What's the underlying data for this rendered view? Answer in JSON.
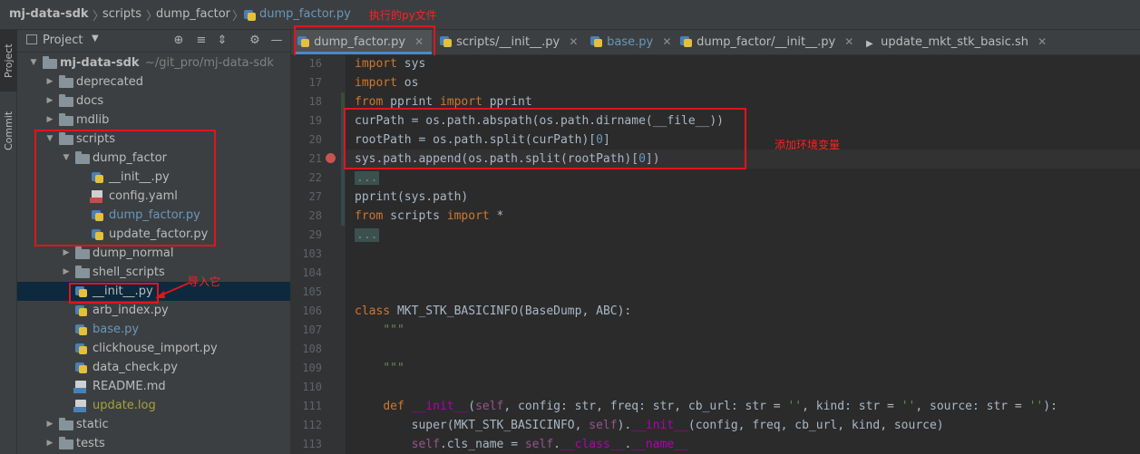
{
  "breadcrumb": {
    "items": [
      "mj-data-sdk",
      "scripts",
      "dump_factor",
      "dump_factor.py"
    ],
    "annotation": "执行的py文件"
  },
  "stripe": {
    "project_label": "Project",
    "commit_label": "Commit"
  },
  "project_panel": {
    "title": "Project",
    "tree": [
      {
        "label": "mj-data-sdk",
        "hint": "~/git_pro/mj-data-sdk",
        "kind": "folder",
        "expanded": true
      },
      {
        "label": "deprecated",
        "kind": "folder"
      },
      {
        "label": "docs",
        "kind": "folder"
      },
      {
        "label": "mdlib",
        "kind": "folder"
      },
      {
        "label": "scripts",
        "kind": "folder",
        "expanded": true
      },
      {
        "label": "dump_factor",
        "kind": "folder",
        "expanded": true
      },
      {
        "label": "__init__.py",
        "kind": "py"
      },
      {
        "label": "config.yaml",
        "kind": "yaml"
      },
      {
        "label": "dump_factor.py",
        "kind": "py",
        "color": "blue"
      },
      {
        "label": "update_factor.py",
        "kind": "py"
      },
      {
        "label": "dump_normal",
        "kind": "folder"
      },
      {
        "label": "shell_scripts",
        "kind": "folder"
      },
      {
        "label": "__init__.py",
        "kind": "py",
        "selected": true
      },
      {
        "label": "arb_index.py",
        "kind": "py"
      },
      {
        "label": "base.py",
        "kind": "py",
        "color": "blue"
      },
      {
        "label": "clickhouse_import.py",
        "kind": "py"
      },
      {
        "label": "data_check.py",
        "kind": "py"
      },
      {
        "label": "README.md",
        "kind": "md"
      },
      {
        "label": "update.log",
        "kind": "log",
        "color": "yellow"
      },
      {
        "label": "static",
        "kind": "folder"
      },
      {
        "label": "tests",
        "kind": "folder"
      }
    ],
    "import_annotation": "导入它"
  },
  "tabs": [
    {
      "label": "dump_factor.py",
      "active": true
    },
    {
      "label": "scripts/__init__.py",
      "active": false
    },
    {
      "label": "base.py",
      "active": false,
      "color": "blue"
    },
    {
      "label": "dump_factor/__init__.py",
      "active": false
    },
    {
      "label": "update_mkt_stk_basic.sh",
      "active": false
    }
  ],
  "editor": {
    "env_annotation": "添加环境变量",
    "line_numbers": [
      "16",
      "17",
      "18",
      "19",
      "20",
      "21",
      "22",
      "27",
      "28",
      "29",
      "103",
      "104",
      "105",
      "106",
      "107",
      "108",
      "109",
      "110",
      "111",
      "112",
      "113"
    ]
  },
  "colors": {
    "accent": "#4a88c7",
    "annotation_red": "#e1141c",
    "keyword": "#cc7832",
    "string": "#6a8759",
    "number": "#6897bb"
  }
}
